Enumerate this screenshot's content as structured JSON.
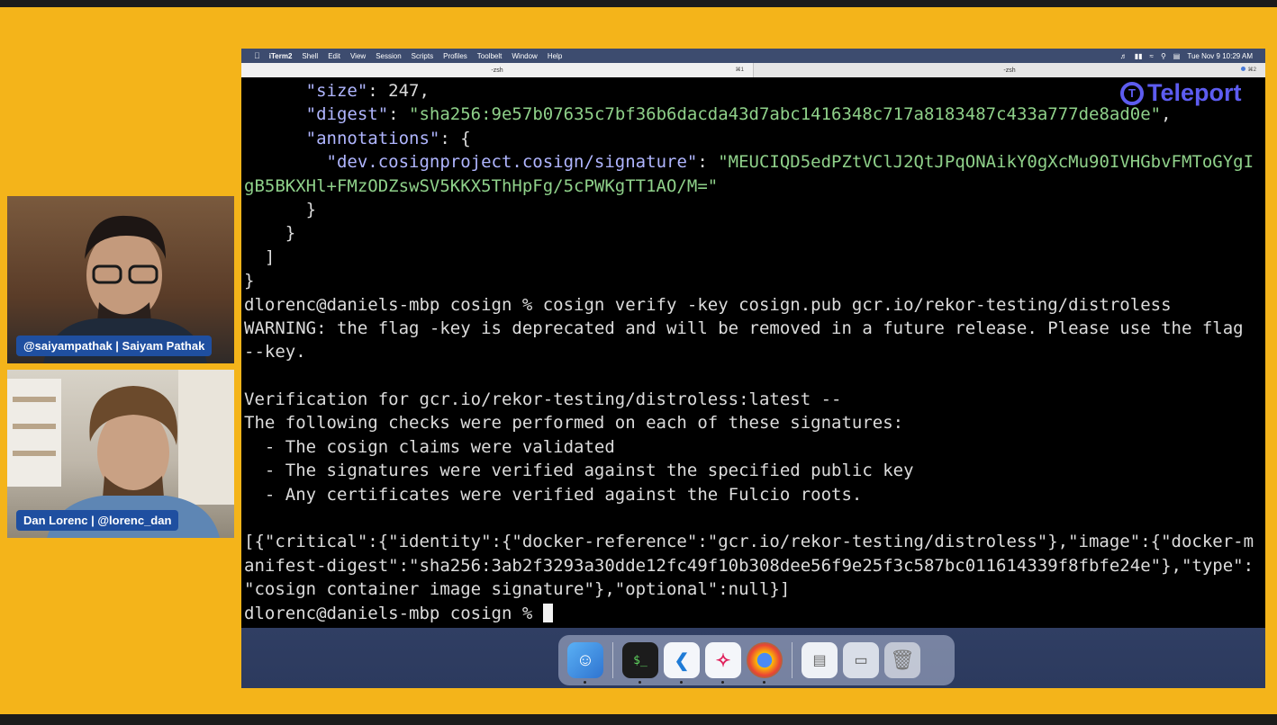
{
  "menubar": {
    "app": "iTerm2",
    "items": [
      "Shell",
      "Edit",
      "View",
      "Session",
      "Scripts",
      "Profiles",
      "Toolbelt",
      "Window",
      "Help"
    ],
    "clock": "Tue Nov 9  10:29 AM"
  },
  "tabs": [
    {
      "title": "-zsh",
      "shortcut": "⌘1"
    },
    {
      "title": "-zsh",
      "shortcut": "⌘2"
    }
  ],
  "terminal": {
    "lines": {
      "l1_key": "\"size\"",
      "l1_rest": ": 247,",
      "l2_key": "\"digest\"",
      "l2_colon": ": ",
      "l2_val": "\"sha256:9e57b07635c7bf36b6dacda43d7abc1416348c717a8183487c433a777de8ad0e\"",
      "l2_end": ",",
      "l3_key": "\"annotations\"",
      "l3_rest": ": {",
      "l4_key": "\"dev.cosignproject.cosign/signature\"",
      "l4_colon": ": ",
      "l4_val": "\"MEUCIQD5edPZtVClJ2QtJPqONAikY0gXcMu90IVHGbvFMToGYgI",
      "l5_val": "gB5BKXHl+FMzODZswSV5KKX5ThHpFg/5cPWKgTT1AO/M=\"",
      "l6": "      }",
      "l7": "    }",
      "l8": "  ]",
      "l9": "}",
      "l10": "dlorenc@daniels-mbp cosign % cosign verify -key cosign.pub gcr.io/rekor-testing/distroless",
      "l11": "WARNING: the flag -key is deprecated and will be removed in a future release. Please use the flag",
      "l12": "--key.",
      "l13": "",
      "l14": "Verification for gcr.io/rekor-testing/distroless:latest --",
      "l15": "The following checks were performed on each of these signatures:",
      "l16": "  - The cosign claims were validated",
      "l17": "  - The signatures were verified against the specified public key",
      "l18": "  - Any certificates were verified against the Fulcio roots.",
      "l19": "",
      "l20": "[{\"critical\":{\"identity\":{\"docker-reference\":\"gcr.io/rekor-testing/distroless\"},\"image\":{\"docker-m",
      "l21": "anifest-digest\":\"sha256:3ab2f3293a30dde12fc49f10b308dee56f9e25f3c587bc011614339f8fbfe24e\"},\"type\":",
      "l22": "\"cosign container image signature\"},\"optional\":null}]",
      "l23": "dlorenc@daniels-mbp cosign % "
    }
  },
  "dock": {
    "apps": [
      "finder-icon",
      "terminal-icon",
      "vscode-icon",
      "slack-icon",
      "chrome-icon",
      "preview-icon",
      "window-icon",
      "trash-icon"
    ]
  },
  "overlay": {
    "brand": "Teleport"
  },
  "participants": [
    {
      "label": "@saiyampathak | Saiyam Pathak"
    },
    {
      "label": "Dan Lorenc | @lorenc_dan"
    }
  ],
  "colors": {
    "background": "#f4b41a",
    "json_key": "#b0b6ff",
    "json_string": "#8fd18a",
    "name_badge": "#1f4fa0",
    "brand": "#5d5cf0"
  }
}
